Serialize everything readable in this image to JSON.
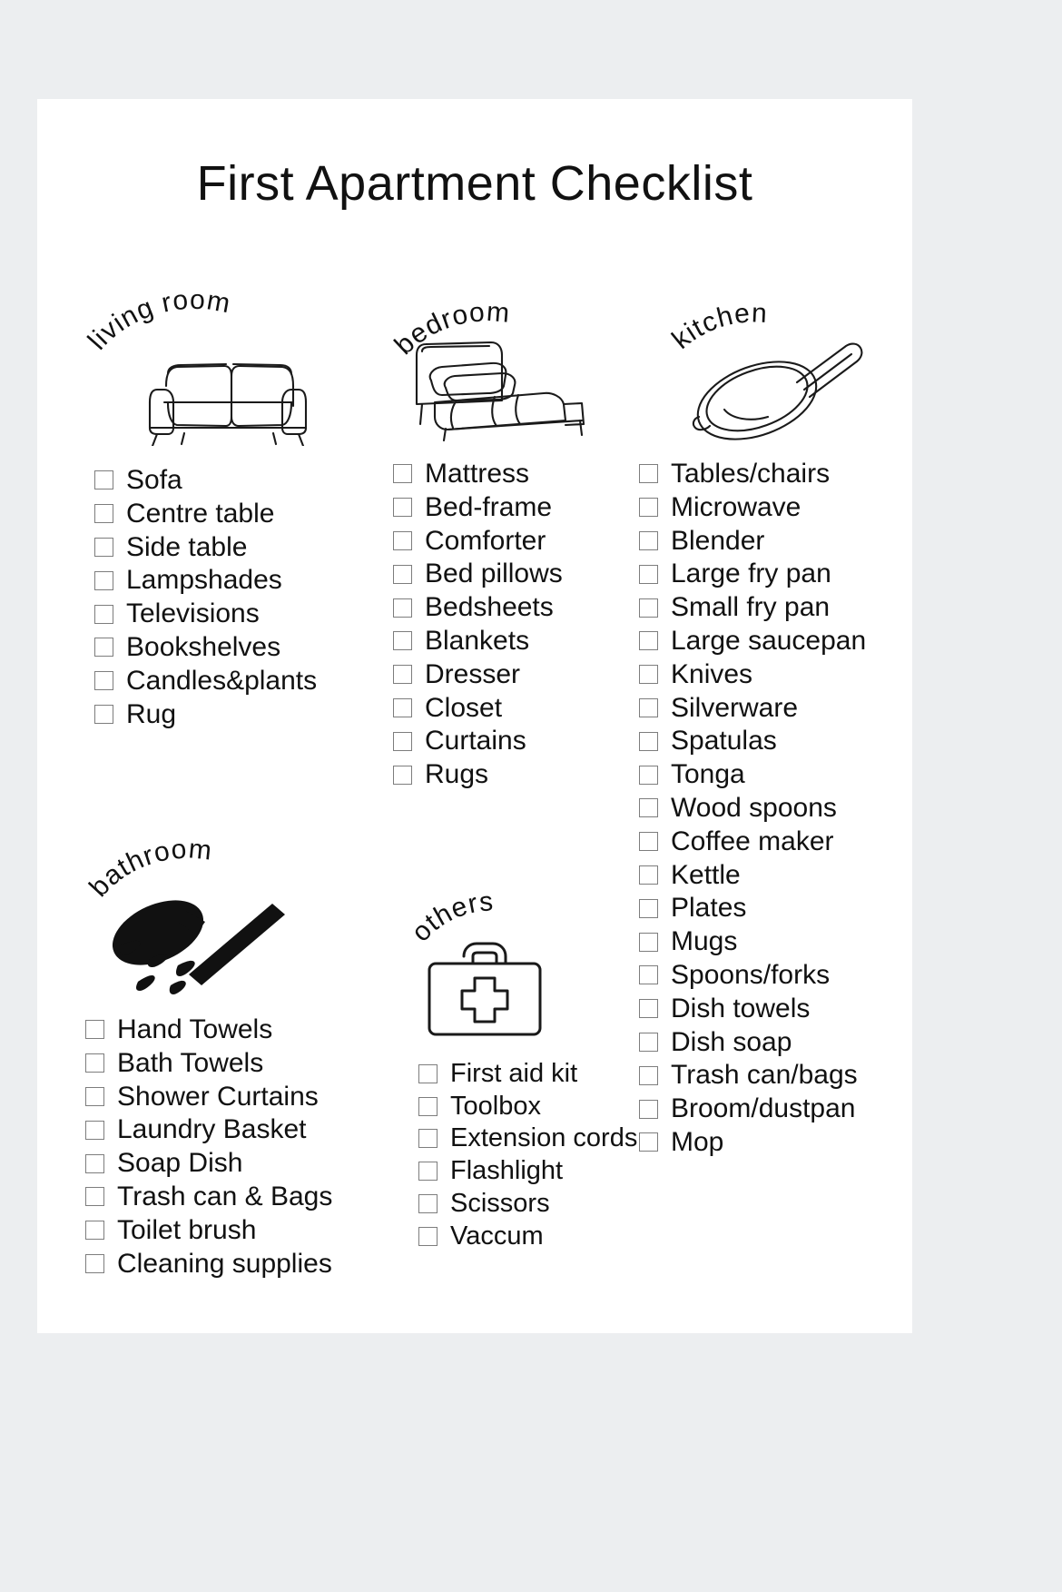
{
  "page": {
    "title": "First Apartment Checklist",
    "background_color": "#eceef0",
    "sheet_color": "#ffffff",
    "text_color": "#111111",
    "checkbox_border_color": "#7d7d7d"
  },
  "sections": [
    {
      "id": "living-room",
      "label": "living room",
      "icon": "sofa-icon",
      "items": [
        "Sofa",
        "Centre table",
        "Side table",
        "Lampshades",
        "Televisions",
        "Bookshelves",
        "Candles&plants",
        "Rug"
      ]
    },
    {
      "id": "bedroom",
      "label": "bedroom",
      "icon": "bed-icon",
      "items": [
        "Mattress",
        "Bed-frame",
        "Comforter",
        "Bed pillows",
        "Bedsheets",
        "Blankets",
        "Dresser",
        "Closet",
        "Curtains",
        "Rugs"
      ]
    },
    {
      "id": "kitchen",
      "label": "kitchen",
      "icon": "frying-pan-icon",
      "items": [
        "Tables/chairs",
        "Microwave",
        "Blender",
        "Large fry pan",
        "Small fry pan",
        "Large saucepan",
        "Knives",
        "Silverware",
        "Spatulas",
        "Tonga",
        "Wood spoons",
        "Coffee maker",
        "Kettle",
        "Plates",
        "Mugs",
        "Spoons/forks",
        "Dish towels",
        "Dish soap",
        "Trash can/bags",
        "Broom/dustpan",
        "Mop"
      ]
    },
    {
      "id": "bathroom",
      "label": "bathroom",
      "icon": "shower-icon",
      "items": [
        "Hand Towels",
        "Bath Towels",
        "Shower Curtains",
        "Laundry Basket",
        "Soap Dish",
        "Trash can & Bags",
        "Toilet brush",
        "Cleaning supplies"
      ]
    },
    {
      "id": "others",
      "label": "others",
      "icon": "first-aid-kit-icon",
      "items": [
        "First aid kit",
        "Toolbox",
        "Extension cords",
        "Flashlight",
        "Scissors",
        "Vaccum"
      ]
    }
  ]
}
